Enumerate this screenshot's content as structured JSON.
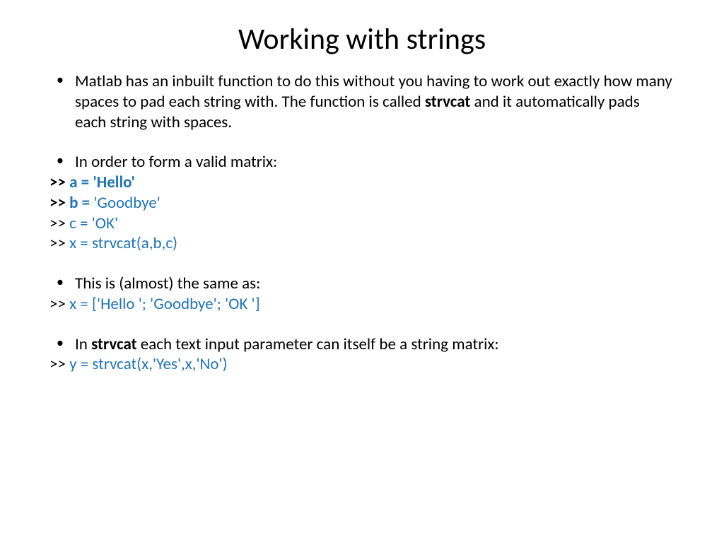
{
  "title": "Working with strings",
  "bullets": {
    "b1_pre": "Matlab has an inbuilt function to do this without you having to work out exactly how many spaces to pad each string with. The function is called ",
    "b1_bold": "strvcat",
    "b1_post": " and it automatically pads each string with spaces.",
    "b2": "In order to form a valid matrix:",
    "b3": "This is (almost) the same as:",
    "b4_pre": "In ",
    "b4_bold": "strvcat",
    "b4_post": " each text input parameter can itself be a string matrix:"
  },
  "code": {
    "l1_prompt": ">> ",
    "l1_code": "a = 'Hello'",
    "l2_prompt": ">> ",
    "l2_bold": "b = ",
    "l2_rest": "'Goodbye'",
    "l3_prompt": ">> ",
    "l3_code": "c = 'OK'",
    "l4_prompt": ">> ",
    "l4_code": "x = strvcat(a,b,c)",
    "l5_prompt": ">> ",
    "l5_code": "x = ['Hello '; 'Goodbye'; 'OK ']",
    "l6_prompt": ">> ",
    "l6_code": "y = strvcat(x,'Yes',x,'No')"
  }
}
